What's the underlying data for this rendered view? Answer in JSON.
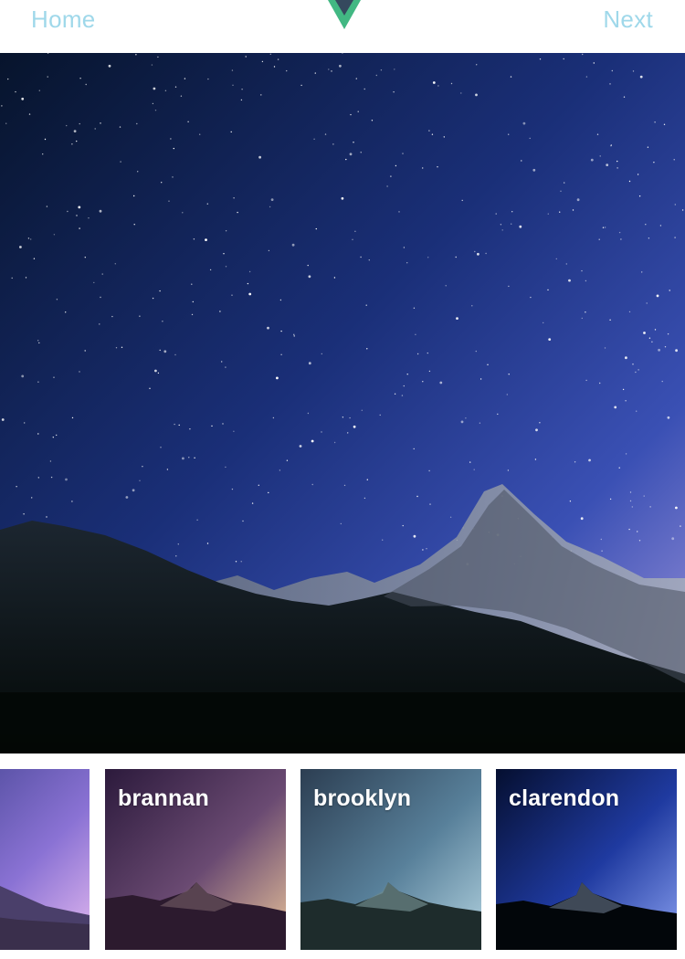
{
  "header": {
    "home_label": "Home",
    "next_label": "Next",
    "logo_icon": "vue-logo-icon",
    "link_color": "#9fd8ea",
    "logo_colors": {
      "outer": "#42b883",
      "inner": "#35495e"
    }
  },
  "preview": {
    "description_icon": "starry-mountain-photo"
  },
  "filters": [
    {
      "label": "",
      "style": "violet"
    },
    {
      "label": "brannan"
    },
    {
      "label": "brooklyn"
    },
    {
      "label": "clarendon"
    }
  ]
}
